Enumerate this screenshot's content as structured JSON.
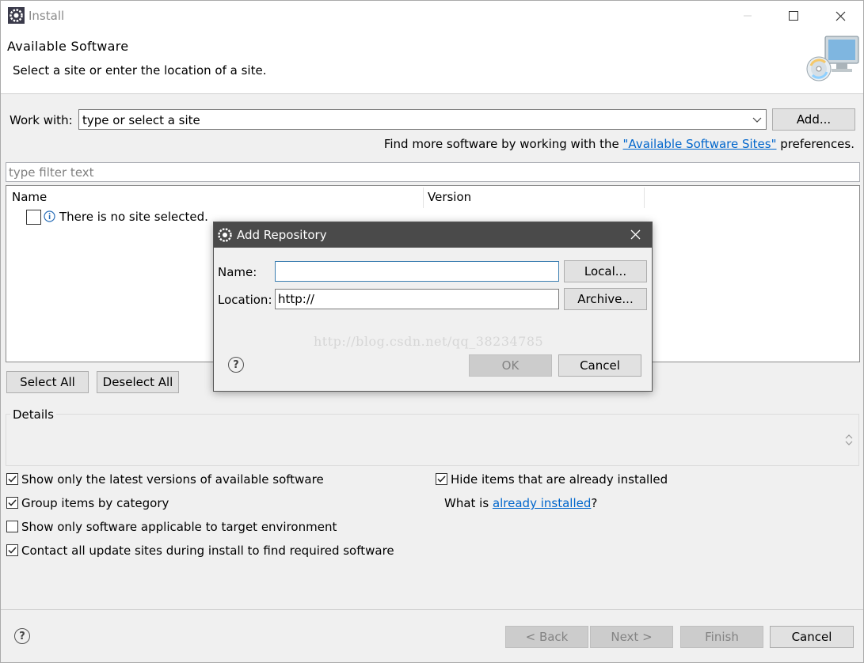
{
  "window": {
    "title": "Install"
  },
  "banner": {
    "heading": "Available Software",
    "subtitle": "Select a site or enter the location of a site."
  },
  "work_with": {
    "label": "Work with:",
    "value": "type or select a site",
    "add_button": "Add..."
  },
  "find_more": {
    "prefix": "Find more software by working with the ",
    "link": "\"Available Software Sites\"",
    "suffix": " preferences."
  },
  "filter": {
    "placeholder": "type filter text"
  },
  "tree": {
    "columns": [
      "Name",
      "Version"
    ],
    "empty_message": "There is no site selected."
  },
  "selection_buttons": {
    "select_all": "Select All",
    "deselect_all": "Deselect All"
  },
  "details": {
    "label": "Details"
  },
  "options": {
    "left": [
      {
        "label": "Show only the latest versions of available software",
        "checked": true
      },
      {
        "label": "Group items by category",
        "checked": true
      },
      {
        "label": "Show only software applicable to target environment",
        "checked": false
      },
      {
        "label": "Contact all update sites during install to find required software",
        "checked": true
      }
    ],
    "hide_installed": {
      "label": "Hide items that are already installed",
      "checked": true
    },
    "what_is": {
      "prefix": "What is ",
      "link": "already installed",
      "suffix": "?"
    }
  },
  "footer": {
    "back": "< Back",
    "next": "Next >",
    "finish": "Finish",
    "cancel": "Cancel"
  },
  "dialog": {
    "title": "Add Repository",
    "name_label": "Name:",
    "name_value": "",
    "location_label": "Location:",
    "location_value": "http://",
    "local_button": "Local...",
    "archive_button": "Archive...",
    "ok_button": "OK",
    "cancel_button": "Cancel",
    "watermark": "http://blog.csdn.net/qq_38234785"
  },
  "colors": {
    "link": "#0066cc",
    "dialog_titlebar": "#4a4a4a",
    "focus_border": "#3c7fb1"
  }
}
